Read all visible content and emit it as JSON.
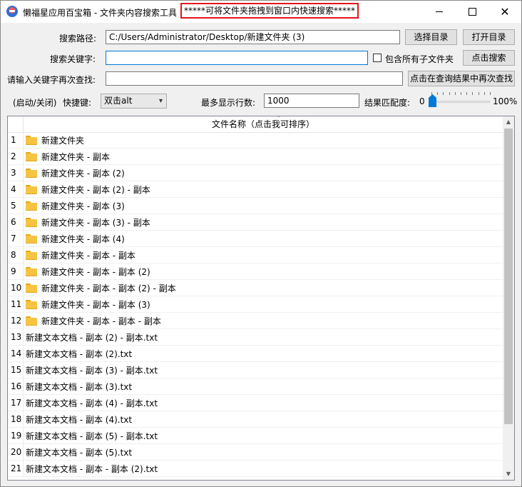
{
  "window": {
    "title": "懒福星应用百宝箱 - 文件夹内容搜索工具",
    "hint": "*****可将文件夹拖拽到窗口内快速搜索*****"
  },
  "form": {
    "path_label": "搜索路径:",
    "path_value": "C:/Users/Administrator/Desktop/新建文件夹 (3)",
    "choose_dir_button": "选择目录",
    "open_dir_button": "打开目录",
    "keyword_label": "搜索关键字:",
    "keyword_value": "",
    "include_subfolders_label": "包含所有子文件夹",
    "include_subfolders_checked": false,
    "search_button": "点击搜索",
    "refine_label": "请输入关键字再次查找:",
    "refine_value": "",
    "refine_button": "点击在查询结果中再次查找",
    "hotkey_toggle_label": "(启动/关闭)",
    "hotkey_label": "快捷键:",
    "hotkey_value": "双击alt",
    "max_rows_label": "最多显示行数:",
    "max_rows_value": "1000",
    "match_label": "结果匹配度:",
    "match_min": "0",
    "match_max": "100%",
    "match_value_percent": 0
  },
  "list": {
    "header_name": "文件名称（点击我可排序）",
    "rows": [
      {
        "num": "1",
        "name": "新建文件夹",
        "icon": "folder-icon"
      },
      {
        "num": "2",
        "name": "新建文件夹 - 副本",
        "icon": "folder-icon"
      },
      {
        "num": "3",
        "name": "新建文件夹 - 副本 (2)",
        "icon": "folder-icon"
      },
      {
        "num": "4",
        "name": "新建文件夹 - 副本 (2) - 副本",
        "icon": "folder-icon"
      },
      {
        "num": "5",
        "name": "新建文件夹 - 副本 (3)",
        "icon": "folder-icon"
      },
      {
        "num": "6",
        "name": "新建文件夹 - 副本 (3) - 副本",
        "icon": "folder-icon"
      },
      {
        "num": "7",
        "name": "新建文件夹 - 副本 (4)",
        "icon": "folder-icon"
      },
      {
        "num": "8",
        "name": "新建文件夹 - 副本 - 副本",
        "icon": "folder-icon"
      },
      {
        "num": "9",
        "name": "新建文件夹 - 副本 - 副本 (2)",
        "icon": "folder-icon"
      },
      {
        "num": "10",
        "name": "新建文件夹 - 副本 - 副本 (2) - 副本",
        "icon": "folder-icon"
      },
      {
        "num": "11",
        "name": "新建文件夹 - 副本 - 副本 (3)",
        "icon": "folder-icon"
      },
      {
        "num": "12",
        "name": "新建文件夹 - 副本 - 副本 - 副本",
        "icon": "folder-icon"
      },
      {
        "num": "13",
        "name": "新建文本文档 - 副本 (2) - 副本.txt",
        "icon": ""
      },
      {
        "num": "14",
        "name": "新建文本文档 - 副本 (2).txt",
        "icon": ""
      },
      {
        "num": "15",
        "name": "新建文本文档 - 副本 (3) - 副本.txt",
        "icon": ""
      },
      {
        "num": "16",
        "name": "新建文本文档 - 副本 (3).txt",
        "icon": ""
      },
      {
        "num": "17",
        "name": "新建文本文档 - 副本 (4) - 副本.txt",
        "icon": ""
      },
      {
        "num": "18",
        "name": "新建文本文档 - 副本 (4).txt",
        "icon": ""
      },
      {
        "num": "19",
        "name": "新建文本文档 - 副本 (5) - 副本.txt",
        "icon": ""
      },
      {
        "num": "20",
        "name": "新建文本文档 - 副本 (5).txt",
        "icon": ""
      },
      {
        "num": "21",
        "name": "新建文本文档 - 副本 - 副本 (2).txt",
        "icon": ""
      }
    ]
  },
  "colors": {
    "hint_border": "#e3141d",
    "focus_border": "#0078d7",
    "slider_thumb": "#0078d7",
    "folder": "#f6c443"
  }
}
